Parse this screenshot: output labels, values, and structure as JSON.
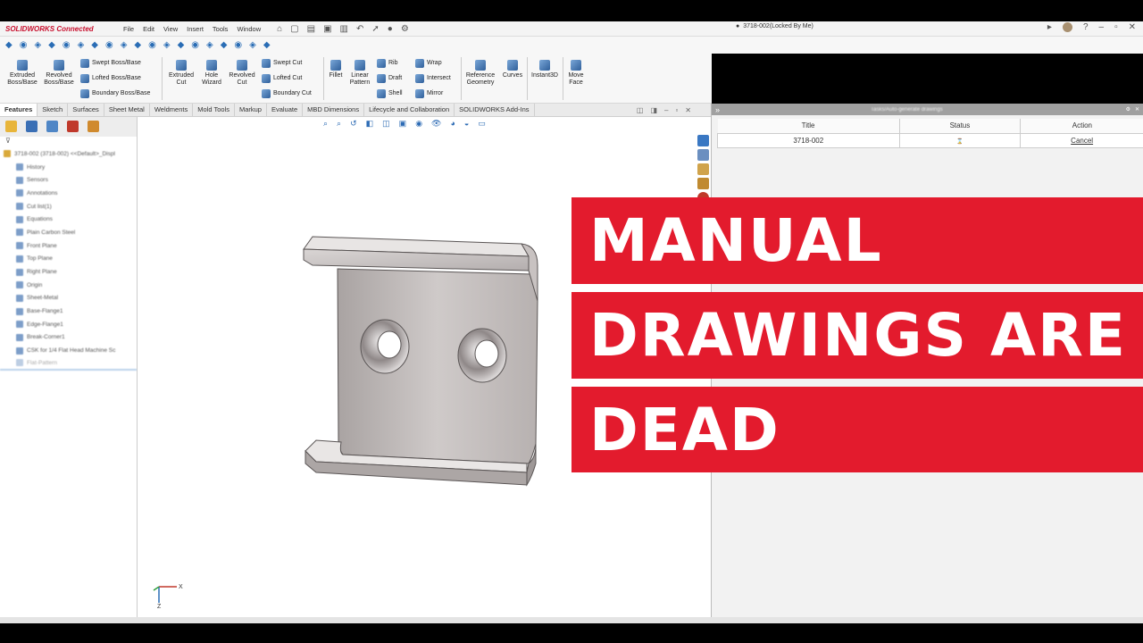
{
  "app": {
    "logo": "SOLIDWORKS Connected",
    "menu": [
      "File",
      "Edit",
      "View",
      "Insert",
      "Tools",
      "Window"
    ],
    "document_title": "3718-002(Locked By Me)"
  },
  "commands": {
    "extruded_boss": "Extruded Boss/Base",
    "revolved_boss": "Revolved Boss/Base",
    "swept_boss": "Swept Boss/Base",
    "lofted_boss": "Lofted Boss/Base",
    "boundary_boss": "Boundary Boss/Base",
    "extruded_cut": "Extruded Cut",
    "hole_wizard": "Hole Wizard",
    "revolved_cut": "Revolved Cut",
    "swept_cut": "Swept Cut",
    "lofted_cut": "Lofted Cut",
    "boundary_cut": "Boundary Cut",
    "fillet": "Fillet",
    "linear_pattern": "Linear Pattern",
    "rib": "Rib",
    "draft": "Draft",
    "shell": "Shell",
    "wrap": "Wrap",
    "intersect": "Intersect",
    "mirror": "Mirror",
    "reference_geometry": "Reference Geometry",
    "curves": "Curves",
    "instant3d": "Instant3D",
    "move_face": "Move Face"
  },
  "tabs": [
    "Features",
    "Sketch",
    "Surfaces",
    "Sheet Metal",
    "Weldments",
    "Mold Tools",
    "Markup",
    "Evaluate",
    "MBD Dimensions",
    "Lifecycle and Collaboration",
    "SOLIDWORKS Add-Ins"
  ],
  "tree": {
    "items": [
      "3718-002 (3718-002) <<Default>_Displ",
      "History",
      "Sensors",
      "Annotations",
      "Cut list(1)",
      "Equations",
      "Plain Carbon Steel",
      "Front Plane",
      "Top Plane",
      "Right Plane",
      "Origin",
      "Sheet-Metal",
      "Base-Flange1",
      "Edge-Flange1",
      "Break-Corner1",
      "CSK for 1/4 Flat Head Machine Sc",
      "Flat-Pattern"
    ]
  },
  "taskpane": {
    "header": "Tasks/Auto-generate drawings",
    "columns": [
      "Title",
      "Status",
      "Action"
    ],
    "rows": [
      {
        "title": "3718-002",
        "status": "",
        "action": "Cancel"
      }
    ]
  },
  "triad": {
    "x_label": "X",
    "z_label": "Z"
  },
  "overlay": {
    "line1": "MANUAL",
    "line2": "DRAWINGS ARE",
    "line3": "DEAD"
  },
  "colors": {
    "accent_red": "#e31b2d",
    "logo_red": "#c8102e",
    "icon_blue": "#2e6cb5"
  }
}
